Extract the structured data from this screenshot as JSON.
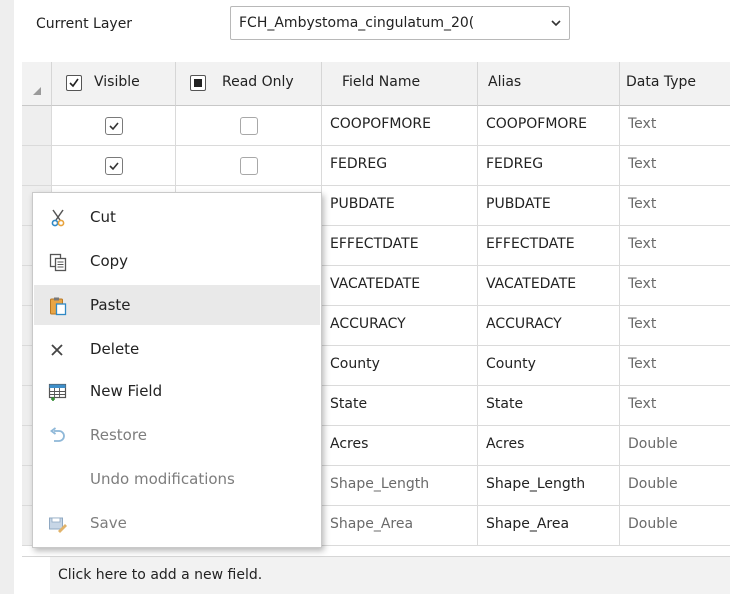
{
  "layer": {
    "label": "Current Layer",
    "value": "FCH_Ambystoma_cingulatum_20("
  },
  "columns": {
    "visible": "Visible",
    "read_only": "Read Only",
    "field_name": "Field Name",
    "alias": "Alias",
    "data_type": "Data Type"
  },
  "rows": [
    {
      "field_name": "COOPOFMORE",
      "alias": "COOPOFMORE",
      "data_type": "Text",
      "visible": true,
      "read_only": false
    },
    {
      "field_name": "FEDREG",
      "alias": "FEDREG",
      "data_type": "Text",
      "visible": true,
      "read_only": false
    },
    {
      "field_name": "PUBDATE",
      "alias": "PUBDATE",
      "data_type": "Text"
    },
    {
      "field_name": "EFFECTDATE",
      "alias": "EFFECTDATE",
      "data_type": "Text"
    },
    {
      "field_name": "VACATEDATE",
      "alias": "VACATEDATE",
      "data_type": "Text"
    },
    {
      "field_name": "ACCURACY",
      "alias": "ACCURACY",
      "data_type": "Text"
    },
    {
      "field_name": "County",
      "alias": "County",
      "data_type": "Text"
    },
    {
      "field_name": "State",
      "alias": "State",
      "data_type": "Text"
    },
    {
      "field_name": "Acres",
      "alias": "Acres",
      "data_type": "Double"
    },
    {
      "field_name": "Shape_Length",
      "alias": "Shape_Length",
      "data_type": "Double",
      "field_name_muted": true
    },
    {
      "field_name": "Shape_Area",
      "alias": "Shape_Area",
      "data_type": "Double",
      "field_name_muted": true
    }
  ],
  "footer": {
    "text": "Click here to add a new field."
  },
  "context_menu": {
    "items": [
      {
        "label": "Cut",
        "icon": "scissors-icon"
      },
      {
        "label": "Copy",
        "icon": "copy-icon"
      },
      {
        "label": "Paste",
        "icon": "paste-icon",
        "highlighted": true
      },
      {
        "label": "Delete",
        "icon": "delete-x-icon"
      },
      {
        "label": "New Field",
        "icon": "new-field-icon"
      },
      {
        "label": "Restore",
        "icon": "restore-icon",
        "disabled": true
      },
      {
        "label": "Undo modifications",
        "icon": "",
        "disabled": true
      },
      {
        "label": "Save",
        "icon": "save-icon",
        "disabled": true
      }
    ]
  },
  "colors": {
    "highlight": "#e9e9e9",
    "row_header": "#eeeeee",
    "header_bg": "#f2f2f2",
    "disabled_text": "#7d7d7d"
  }
}
